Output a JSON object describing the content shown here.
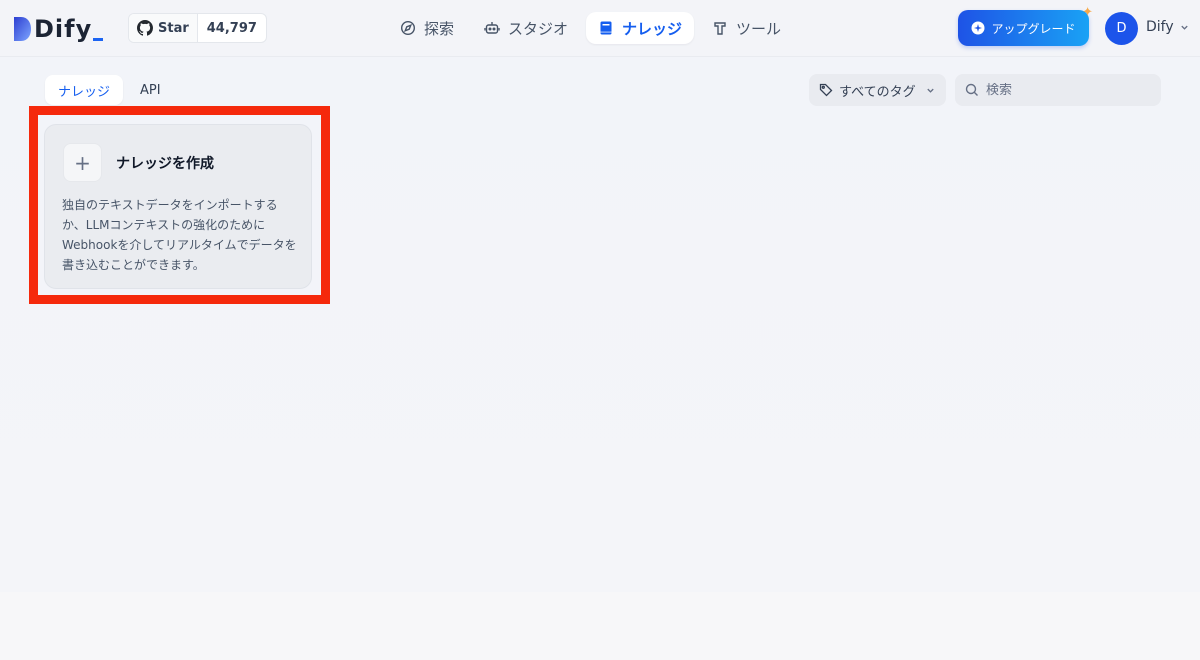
{
  "header": {
    "logo_text": "Dify",
    "github": {
      "star_label": "Star",
      "star_count": "44,797"
    },
    "nav": [
      {
        "label": "探索",
        "icon": "compass-icon",
        "active": false
      },
      {
        "label": "スタジオ",
        "icon": "robot-icon",
        "active": false
      },
      {
        "label": "ナレッジ",
        "icon": "book-icon",
        "active": true
      },
      {
        "label": "ツール",
        "icon": "hammer-icon",
        "active": false
      }
    ],
    "upgrade_label": "アップグレード",
    "avatar_initial": "D",
    "account_name": "Dify"
  },
  "toolbar": {
    "tabs": [
      {
        "label": "ナレッジ",
        "active": true
      },
      {
        "label": "API",
        "active": false
      }
    ],
    "tag_filter_label": "すべてのタグ",
    "search_placeholder": "検索"
  },
  "create_card": {
    "title": "ナレッジを作成",
    "description": "独自のテキストデータをインポートするか、LLMコンテキストの強化のためにWebhookを介してリアルタイムでデータを書き込むことができます。"
  },
  "colors": {
    "accent": "#155eef",
    "highlight": "#f5290c",
    "upgrade_start": "#1e53e6",
    "upgrade_end": "#1aa2f5"
  }
}
